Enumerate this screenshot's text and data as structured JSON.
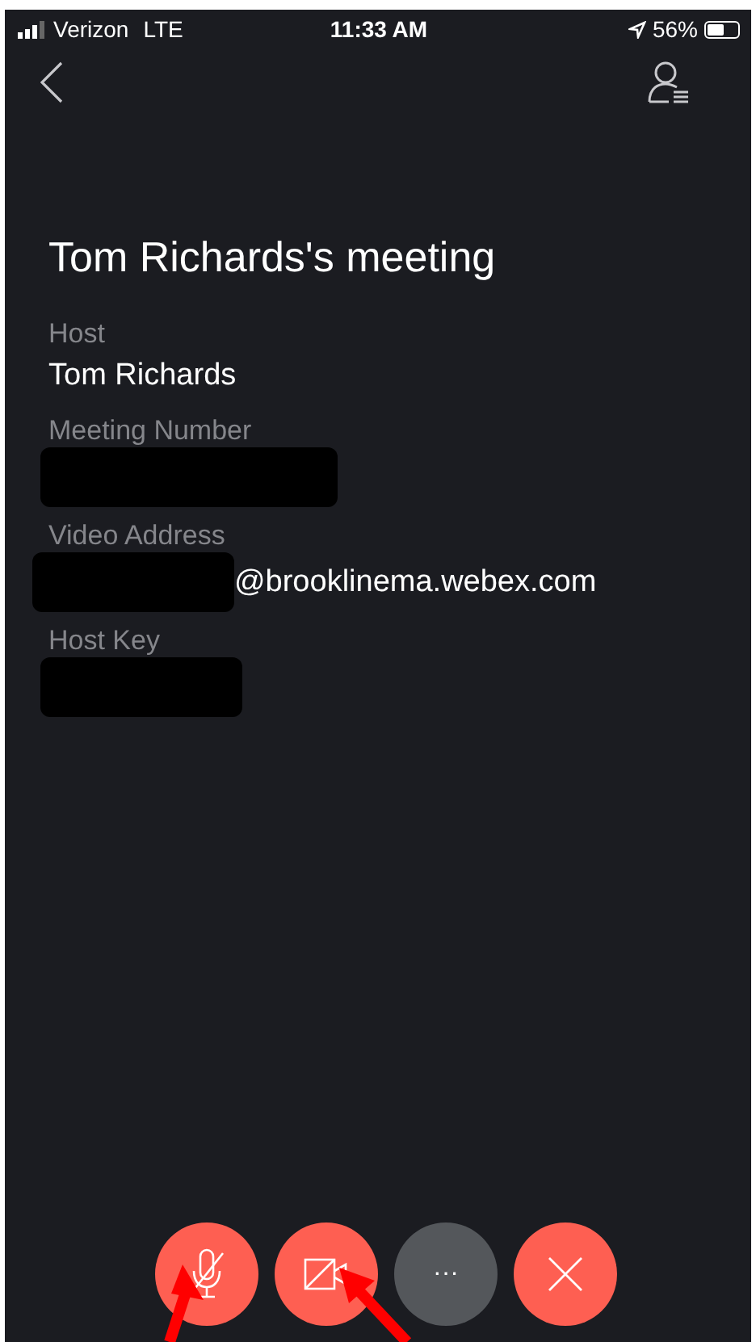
{
  "status_bar": {
    "carrier": "Verizon",
    "network": "LTE",
    "time": "11:33 AM",
    "battery": "56%"
  },
  "title": "Tom Richards's meeting",
  "fields": [
    {
      "label": "Host",
      "value": "Tom Richards",
      "redacted": false
    },
    {
      "label": "Meeting Number",
      "redacted": true
    },
    {
      "label": "Video Address",
      "value": "@brooklinema.webex.com",
      "redacted": true
    },
    {
      "label": "Host Key",
      "redacted": true
    }
  ],
  "controls": [
    {
      "kind": "mic",
      "muted": true
    },
    {
      "kind": "video",
      "muted": true
    },
    {
      "kind": "more",
      "label": "···"
    },
    {
      "kind": "leave"
    }
  ]
}
